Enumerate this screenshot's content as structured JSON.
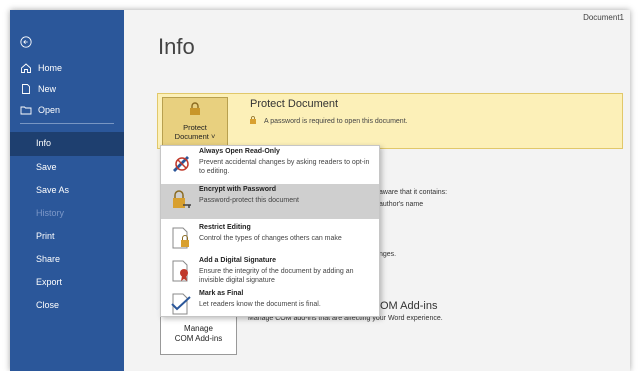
{
  "window": {
    "doc_title": "Document1"
  },
  "sidebar": {
    "back_icon": "back-arrow-icon",
    "items": [
      {
        "label": "Home",
        "icon": "home-icon"
      },
      {
        "label": "New",
        "icon": "new-document-icon"
      },
      {
        "label": "Open",
        "icon": "folder-icon"
      }
    ],
    "nav": [
      {
        "label": "Info",
        "selected": true
      },
      {
        "label": "Save"
      },
      {
        "label": "Save As"
      },
      {
        "label": "History",
        "disabled": true
      },
      {
        "label": "Print"
      },
      {
        "label": "Share"
      },
      {
        "label": "Export"
      },
      {
        "label": "Close"
      }
    ],
    "bg_color": "#2b579a"
  },
  "main": {
    "title": "Info",
    "protect": {
      "button_label_1": "Protect",
      "button_label_2": "Document ˅",
      "heading": "Protect Document",
      "description": "A password is required to open this document."
    },
    "background_text": {
      "inspect_1": "aware that it contains:",
      "inspect_2": "author's name",
      "versions": "nges."
    },
    "addins": {
      "heading": "OM Add-ins",
      "description": "Manage COM add-ins that are affecting your Word experience.",
      "button_label_1": "Manage",
      "button_label_2": "COM Add-ins"
    }
  },
  "dropdown": {
    "items": [
      {
        "title": "Always Open Read-Only",
        "desc": "Prevent accidental changes by asking readers to opt-in to editing."
      },
      {
        "title": "Encrypt with Password",
        "desc": "Password-protect this document",
        "highlighted": true
      },
      {
        "title": "Restrict Editing",
        "desc": "Control the types of changes others can make"
      },
      {
        "title": "Add a Digital Signature",
        "desc": "Ensure the integrity of the document by adding an invisible digital signature"
      },
      {
        "title": "Mark as Final",
        "desc": "Let readers know the document is final."
      }
    ]
  }
}
